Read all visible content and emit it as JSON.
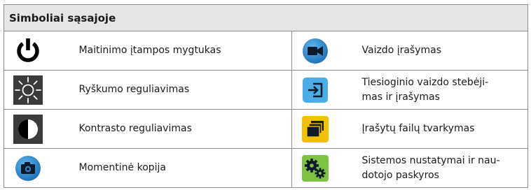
{
  "table": {
    "header": "Simboliai sąsajoje",
    "rows": [
      {
        "left": {
          "icon": "power-button-icon",
          "label": "Maitinimo įtampos mygtukas"
        },
        "right": {
          "icon": "video-recording-icon",
          "label": "Vaizdo įrašymas",
          "color": "#2a8ad4"
        }
      },
      {
        "left": {
          "icon": "brightness-icon",
          "label": "Ryškumo reguliavimas"
        },
        "right": {
          "icon": "live-view-recording-icon",
          "label": "Tiesioginio vaizdo stebėji-\nmas ir įrašymas",
          "color": "#4aaee6"
        }
      },
      {
        "left": {
          "icon": "contrast-icon",
          "label": "Kontrasto reguliavimas"
        },
        "right": {
          "icon": "recorded-files-icon",
          "label": "Įrašytų failų tvarkymas",
          "color": "#f2c100"
        }
      },
      {
        "left": {
          "icon": "snapshot-camera-icon",
          "label": "Momentinė kopija",
          "color": "#2a8ad4"
        },
        "right": {
          "icon": "settings-gears-icon",
          "label": "Sistemos nustatymai ir nau-\ndotojo paskyros",
          "color": "#7dc241"
        }
      }
    ]
  }
}
